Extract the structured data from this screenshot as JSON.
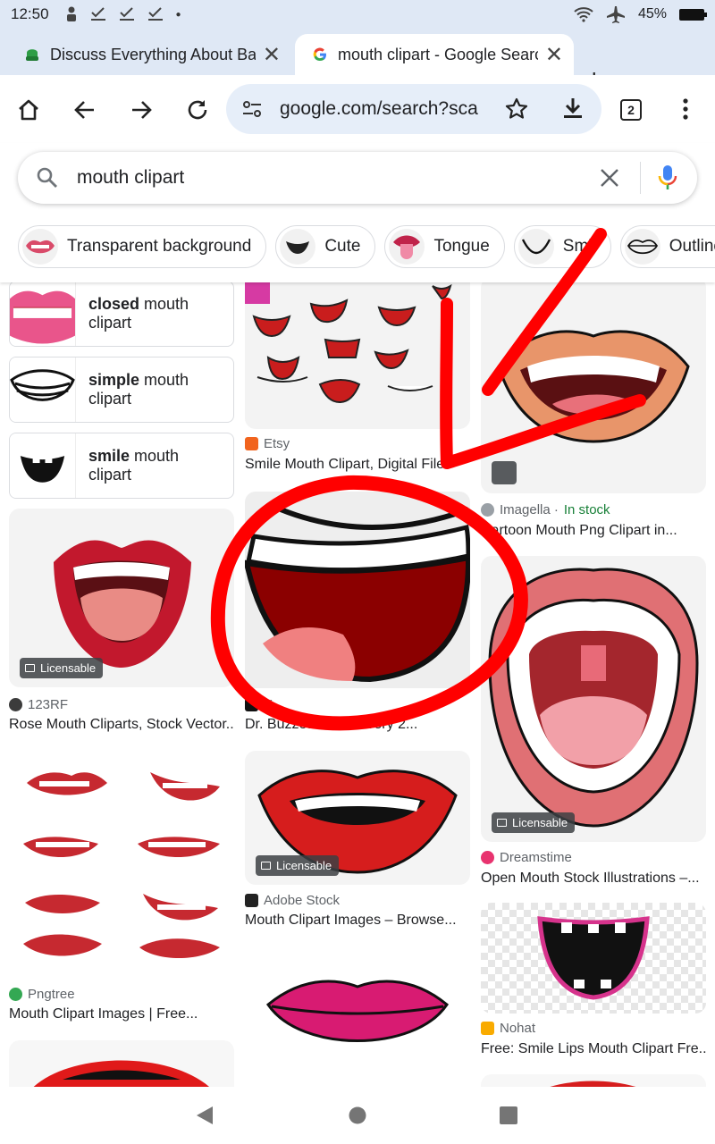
{
  "status": {
    "time": "12:50",
    "battery": "45%"
  },
  "tabs": [
    {
      "title": "Discuss Everything About Ba",
      "active": false
    },
    {
      "title": "mouth clipart - Google Searc",
      "active": true
    }
  ],
  "toolbar": {
    "url": "google.com/search?sca",
    "tab_count": "2"
  },
  "search": {
    "query": "mouth clipart"
  },
  "chips": [
    {
      "label": "Transparent background"
    },
    {
      "label": "Cute"
    },
    {
      "label": "Tongue"
    },
    {
      "label": "Smil"
    },
    {
      "label": "Outline"
    }
  ],
  "related": [
    {
      "bold": "closed",
      "rest": " mouth",
      "line2": "clipart"
    },
    {
      "bold": "simple",
      "rest": " mouth",
      "line2": "clipart"
    },
    {
      "bold": "smile",
      "rest": " mouth",
      "line2": "clipart"
    }
  ],
  "results": [
    {
      "source": "Etsy",
      "caption": "Smile Mouth Clipart, Digital File"
    },
    {
      "source": "Imagella · ",
      "stock": "In stock",
      "caption": "Cartoon Mouth Png Clipart in..."
    },
    {
      "source": "123RF",
      "caption": "Rose Mouth Cliparts, Stock Vector...",
      "badge": "Licensable"
    },
    {
      "source": "X",
      "caption": "Dr. Buzzet on X: \"Every 2...",
      "badge": ""
    },
    {
      "source": "Dreamstime",
      "caption": "Open Mouth Stock Illustrations –...",
      "badge": "Licensable"
    },
    {
      "source": "Adobe Stock",
      "caption": "Mouth Clipart Images – Browse...",
      "badge": "Licensable"
    },
    {
      "source": "Pngtree",
      "caption": "Mouth Clipart Images | Free..."
    },
    {
      "source": "Nohat",
      "caption": "Free: Smile Lips Mouth Clipart Fre..."
    }
  ],
  "colors": {
    "accent": "#1a73e8",
    "annotation": "#ff0000",
    "chrome_bg": "#dfe8f5"
  }
}
